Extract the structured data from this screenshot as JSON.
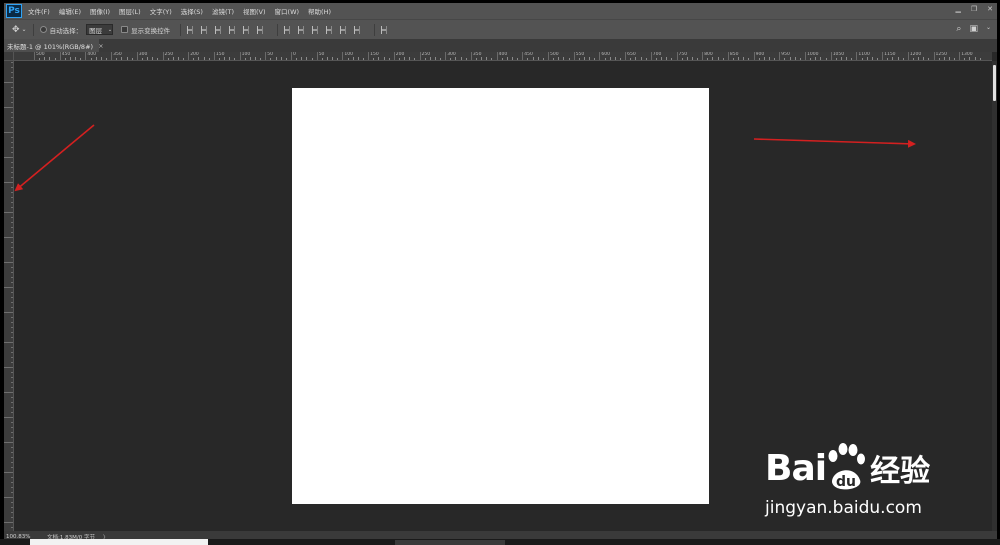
{
  "app": {
    "logo": "Ps",
    "menu": [
      "文件(F)",
      "编辑(E)",
      "图像(I)",
      "图层(L)",
      "文字(Y)",
      "选择(S)",
      "滤镜(T)",
      "视图(V)",
      "窗口(W)",
      "帮助(H)"
    ]
  },
  "options": {
    "auto_select_label": "自动选择：",
    "layer_select_value": "图层",
    "show_transform_label": "显示变换控件"
  },
  "document": {
    "tab_title": "未标题-1 @ 101%(RGB/8#)",
    "tab_close": "×"
  },
  "ruler": {
    "top_labels": [
      "500",
      "450",
      "400",
      "350",
      "300",
      "250",
      "200",
      "150",
      "100",
      "50",
      "0",
      "50",
      "100",
      "150",
      "200",
      "250",
      "300",
      "350",
      "400",
      "450",
      "500",
      "550",
      "600",
      "650",
      "700",
      "750",
      "800",
      "850",
      "900",
      "950",
      "1000",
      "1050",
      "1100",
      "1150",
      "1200",
      "1250",
      "1300"
    ]
  },
  "status": {
    "zoom": "100.83%",
    "doc_info": "文档:1.83M/0 字节",
    "chevron": "〉"
  },
  "watermark": {
    "brand_bai": "Bai",
    "brand_du": "du",
    "brand_suffix": "经验",
    "url": "jingyan.baidu.com"
  },
  "colors": {
    "annotation_arrow": "#d42020",
    "workspace": "#282828",
    "canvas": "#ffffff",
    "paw_blue": "#2a5fcf"
  }
}
